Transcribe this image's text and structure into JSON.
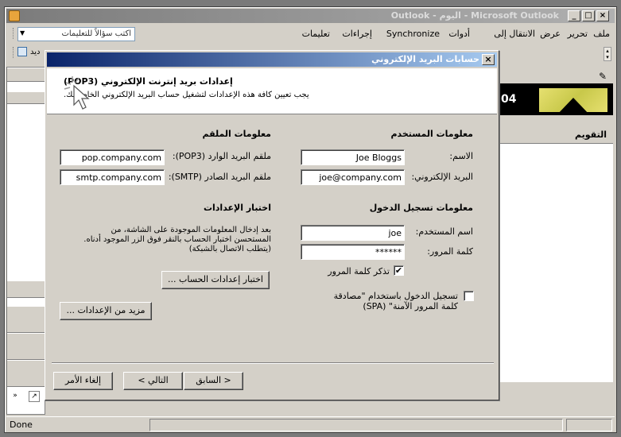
{
  "outlook": {
    "title": "Microsoft Outlook - اليوم - Outlook",
    "menu": [
      {
        "label": "ملف"
      },
      {
        "label": "تحرير"
      },
      {
        "label": "عرض"
      },
      {
        "label": "الانتقال إلى"
      },
      {
        "label": "أدوات"
      },
      {
        "label": "Synchronize"
      },
      {
        "label": "إجراءات"
      },
      {
        "label": "تعليمات"
      }
    ],
    "help_placeholder": "اكتب سؤالاً للتعليمات",
    "toolbar_text": "ديد",
    "today_number": "04",
    "calendar_label": "التقويم",
    "status_text": "Done"
  },
  "dialog": {
    "title": "حسابات البريد الإلكتروني",
    "header_title": "إعدادات بريد إنترنت الإلكتروني (POP3)",
    "header_subtitle": "يجب تعيين كافة هذه الإعدادات لتشغيل حساب البريد الإلكتروني الخاص بك.",
    "user_info": {
      "heading": "معلومات المستخدم",
      "name_label": "الاسم:",
      "name_value": "Joe Bloggs",
      "email_label": "البريد الإلكتروني:",
      "email_value": "joe@company.com"
    },
    "server_info": {
      "heading": "معلومات الملقم",
      "incoming_label": "ملقم البريد الوارد (POP3):",
      "incoming_value": "pop.company.com",
      "outgoing_label": "ملقم البريد الصادر (SMTP):",
      "outgoing_value": "smtp.company.com"
    },
    "logon_info": {
      "heading": "معلومات تسجيل الدخول",
      "username_label": "اسم المستخدم:",
      "username_value": "joe",
      "password_label": "كلمة المرور:",
      "password_value": "******",
      "remember_label": "تذكر كلمة المرور",
      "remember_checked": true,
      "spa_label_line1": "تسجيل الدخول باستخدام \"مصادقة",
      "spa_label_line2": "كلمة المرور الآمنة\" (SPA)",
      "spa_checked": false
    },
    "test_settings": {
      "heading": "اختبار الإعدادات",
      "description_line1": "بعد إدخال المعلومات الموجودة على الشاشة، من",
      "description_line2": "المستحسن اختبار الحساب بالنقر فوق الزر الموجود أدناه.",
      "description_line3": "(يتطلب الاتصال بالشبكة)",
      "test_button": "اختبار إعدادات الحساب ...",
      "more_button": "مزيد من الإعدادات ..."
    },
    "buttons": {
      "back": "< السابق",
      "next": "التالي >",
      "cancel": "إلغاء الأمر"
    }
  }
}
